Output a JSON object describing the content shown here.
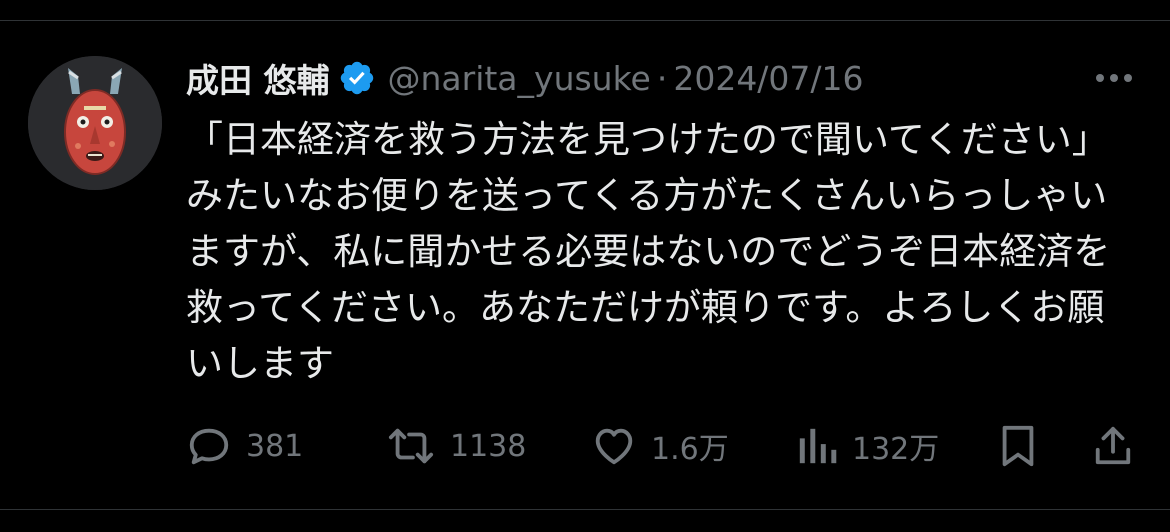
{
  "tweet": {
    "author": {
      "display_name": "成田 悠輔",
      "handle": "@narita_yusuke",
      "verified": true,
      "avatar_icon": "mask-avatar-icon"
    },
    "separator": "·",
    "date": "2024/07/16",
    "text": "「日本経済を救う方法を見つけたので聞いてください」みたいなお便りを送ってくる方がたくさんいらっしゃいますが、私に聞かせる必要はないのでどうぞ日本経済を救ってください。あなただけが頼りです。よろしくお願いします",
    "actions": {
      "replies": "381",
      "reposts": "1138",
      "likes": "1.6万",
      "views": "132万"
    }
  },
  "colors": {
    "background": "#000000",
    "text": "#e7e9ea",
    "secondary": "#71767b",
    "verified": "#1d9bf0",
    "divider": "#2f3336"
  }
}
